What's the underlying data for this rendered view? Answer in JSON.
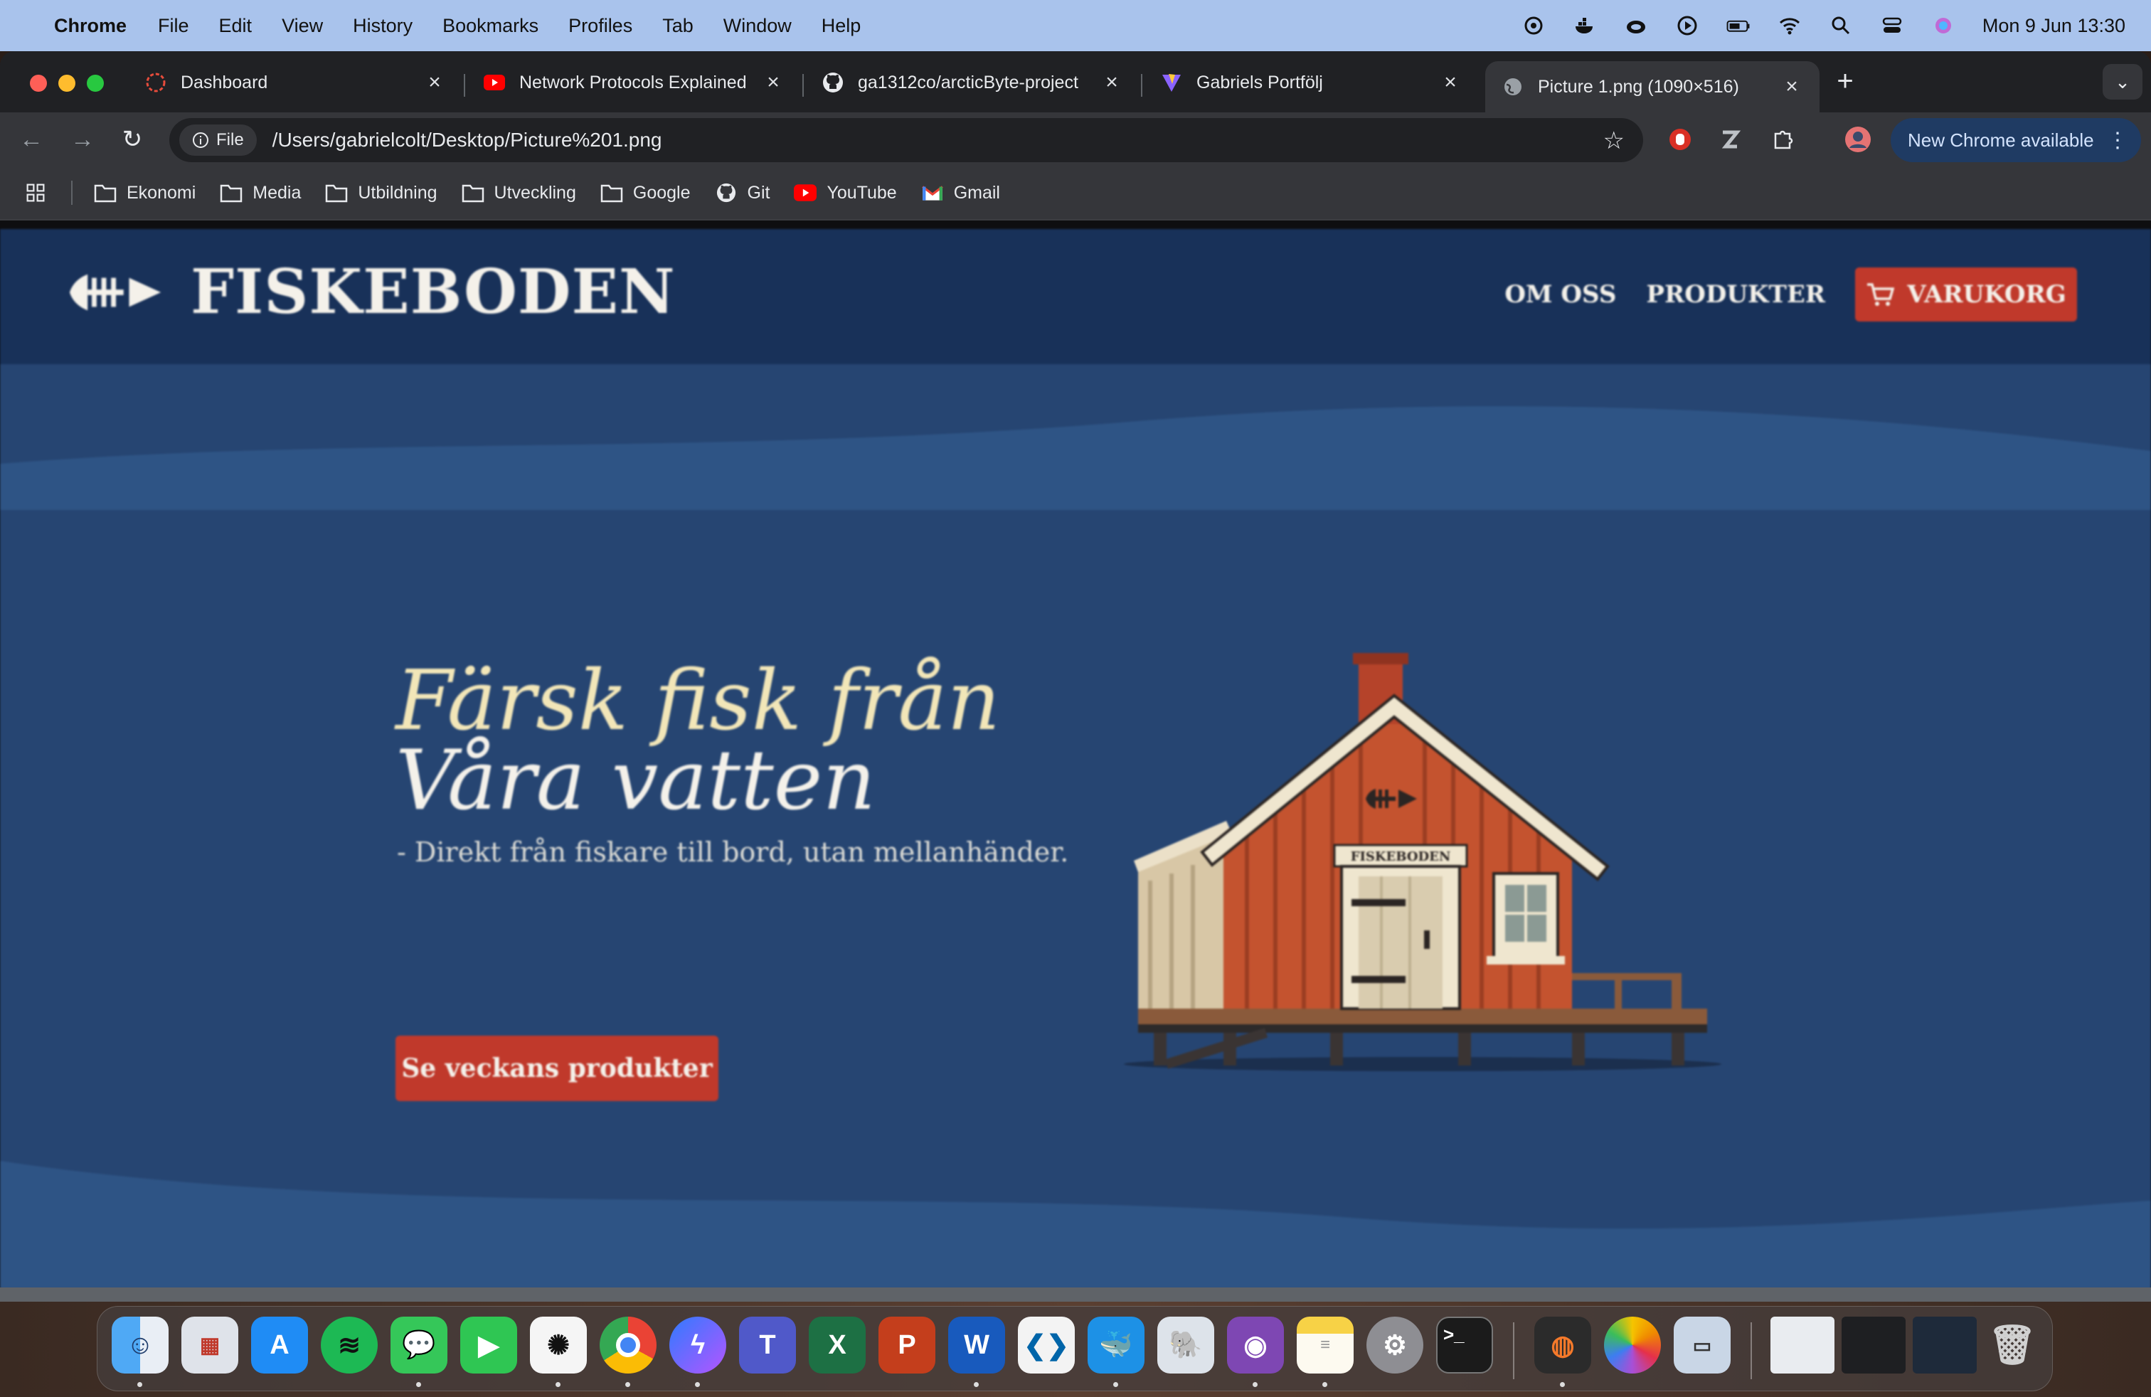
{
  "menubar": {
    "app_name": "Chrome",
    "menus": [
      "File",
      "Edit",
      "View",
      "History",
      "Bookmarks",
      "Profiles",
      "Tab",
      "Window",
      "Help"
    ],
    "clock": "Mon 9 Jun  13:30"
  },
  "tabs": [
    {
      "title": "Dashboard",
      "icon": "dashboard-icon"
    },
    {
      "title": "Network Protocols Explained",
      "icon": "youtube-icon"
    },
    {
      "title": "ga1312co/arcticByte-project",
      "icon": "github-icon"
    },
    {
      "title": "Gabriels Portfölj",
      "icon": "vite-icon"
    },
    {
      "title": "Picture 1.png (1090×516)",
      "icon": "globe-icon",
      "active": true
    }
  ],
  "toolbar": {
    "chip_label": "File",
    "url": "/Users/gabrielcolt/Desktop/Picture%201.png",
    "update_label": "New Chrome available"
  },
  "bookmarks": [
    {
      "label": "Ekonomi",
      "icon": "folder-icon"
    },
    {
      "label": "Media",
      "icon": "folder-icon"
    },
    {
      "label": "Utbildning",
      "icon": "folder-icon"
    },
    {
      "label": "Utveckling",
      "icon": "folder-icon"
    },
    {
      "label": "Google",
      "icon": "folder-icon"
    },
    {
      "label": "Git",
      "icon": "github-icon"
    },
    {
      "label": "YouTube",
      "icon": "youtube-icon"
    },
    {
      "label": "Gmail",
      "icon": "gmail-icon"
    }
  ],
  "site": {
    "brand": "FISKEBODEN",
    "nav": {
      "about": "OM OSS",
      "products": "PRODUKTER",
      "cart": "VARUKORG"
    },
    "hero": {
      "title_line1": "Färsk fisk från",
      "title_line2": "Våra vatten",
      "subtitle": "- Direkt från fiskare till bord, utan mellanhänder.",
      "cta": "Se veckans produkter"
    },
    "house_sign": "FISKEBODEN",
    "colors": {
      "background": "#264572",
      "header": "#183159",
      "accent": "#c0392b",
      "house": "#c4532f"
    }
  },
  "dock": {
    "apps": [
      "Finder",
      "Launchpad",
      "App Store",
      "Spotify",
      "Messages",
      "FaceTime",
      "ChatGPT",
      "Chrome",
      "Messenger",
      "Teams",
      "Excel",
      "PowerPoint",
      "Word",
      "VS Code",
      "Docker",
      "pgAdmin",
      "GitHub Desktop",
      "Notes",
      "System Settings",
      "Terminal",
      "Blender",
      "Photos",
      "Preview",
      "Trash"
    ]
  }
}
